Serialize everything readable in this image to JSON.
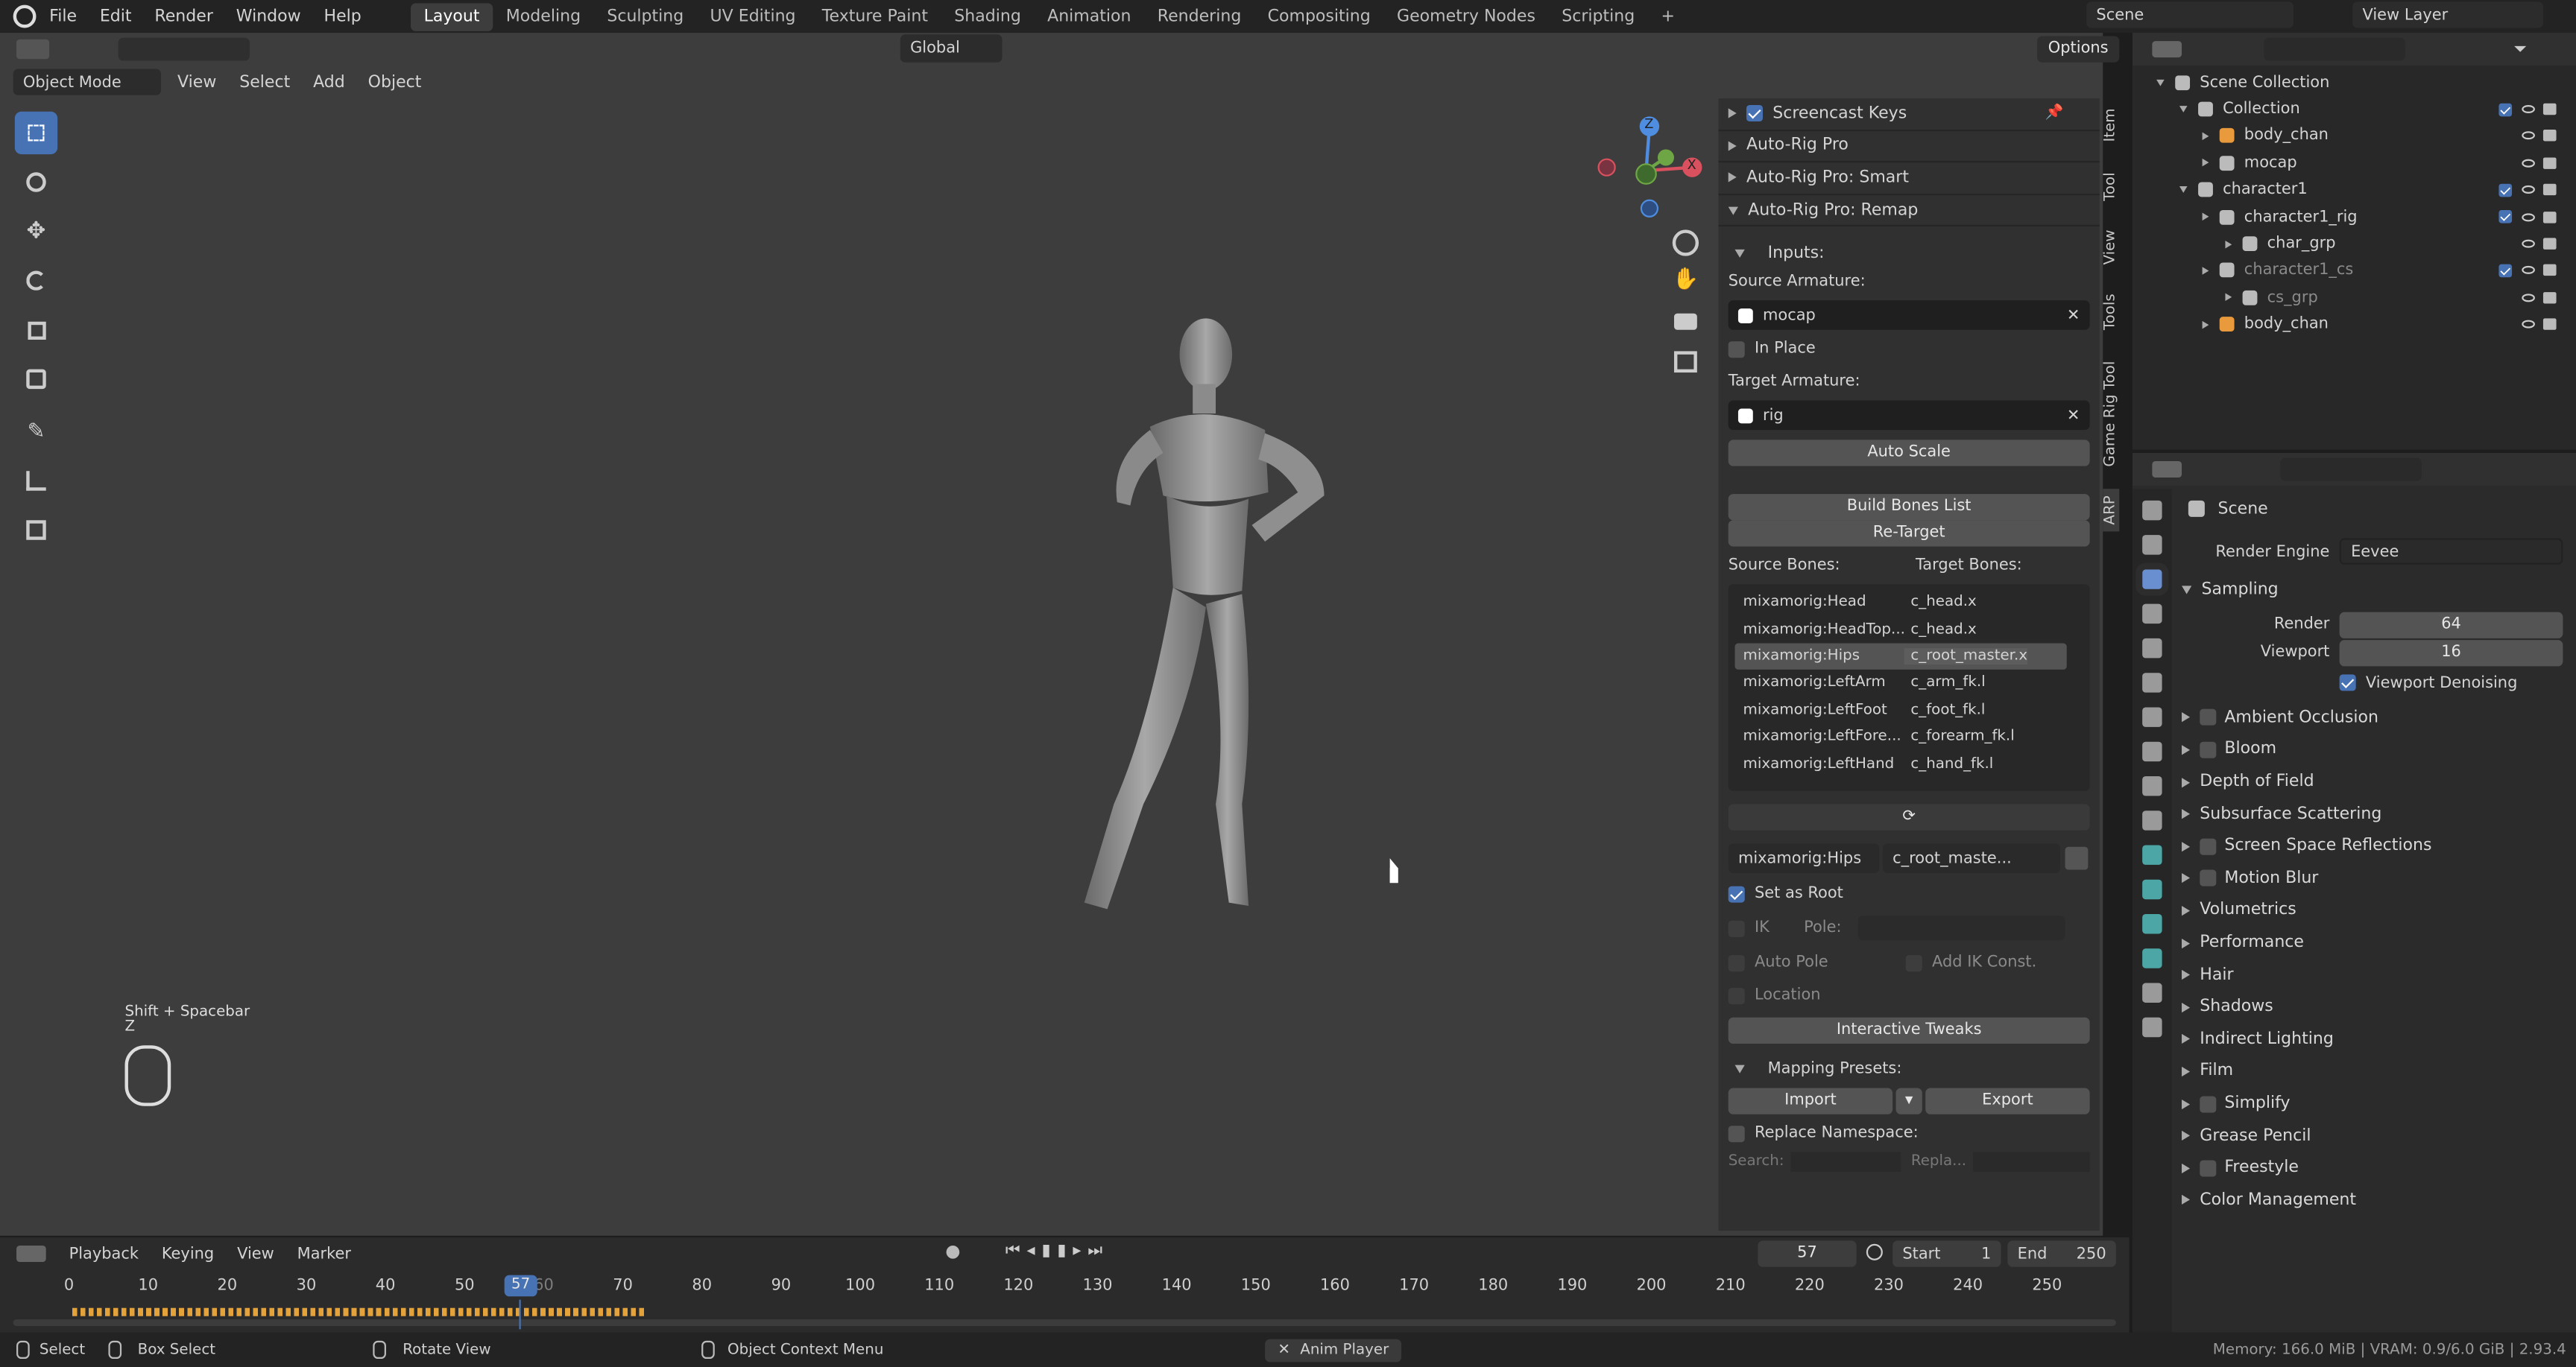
{
  "topbar": {
    "menus": [
      "File",
      "Edit",
      "Render",
      "Window",
      "Help"
    ],
    "workspaces": [
      "Layout",
      "Modeling",
      "Sculpting",
      "UV Editing",
      "Texture Paint",
      "Shading",
      "Animation",
      "Rendering",
      "Compositing",
      "Geometry Nodes",
      "Scripting"
    ],
    "active_workspace": "Layout",
    "add_tab": "+",
    "scene": "Scene",
    "view_layer": "View Layer"
  },
  "viewport_header": {
    "mode": "Object Mode",
    "menus": [
      "View",
      "Select",
      "Add",
      "Object"
    ],
    "orientation": "Global",
    "options": "Options"
  },
  "gizmo": {
    "x": "X",
    "y": "Y",
    "z": "Z"
  },
  "overlay_hint": {
    "keys": "Shift + Spacebar",
    "sub": "Z"
  },
  "npanel": {
    "tabs": [
      "Item",
      "Tool",
      "View",
      "Tools",
      "Game Rig Tool",
      "ARP"
    ],
    "panels": [
      "Screencast Keys",
      "Auto-Rig Pro",
      "Auto-Rig Pro: Smart",
      "Auto-Rig Pro: Remap"
    ],
    "inputs_label": "Inputs:",
    "source_armature_label": "Source Armature:",
    "source_armature": "mocap",
    "in_place": "In Place",
    "target_armature_label": "Target Armature:",
    "target_armature": "rig",
    "auto_scale": "Auto Scale",
    "build_bones": "Build Bones List",
    "retarget": "Re-Target",
    "source_bones_label": "Source Bones:",
    "target_bones_label": "Target Bones:",
    "bones": [
      [
        "mixamorig:Head",
        "c_head.x"
      ],
      [
        "mixamorig:HeadTop...",
        "c_head.x"
      ],
      [
        "mixamorig:Hips",
        "c_root_master.x"
      ],
      [
        "mixamorig:LeftArm",
        "c_arm_fk.l"
      ],
      [
        "mixamorig:LeftFoot",
        "c_foot_fk.l"
      ],
      [
        "mixamorig:LeftFore...",
        "c_forearm_fk.l"
      ],
      [
        "mixamorig:LeftHand",
        "c_hand_fk.l"
      ]
    ],
    "sel_source": "mixamorig:Hips",
    "sel_target": "c_root_maste...",
    "set_as_root": "Set as Root",
    "ik": "IK",
    "pole": "Pole:",
    "auto_pole": "Auto Pole",
    "add_ik": "Add IK Const.",
    "location": "Location",
    "interactive_tweaks": "Interactive Tweaks",
    "mapping_presets": "Mapping Presets:",
    "import": "Import",
    "export": "Export",
    "replace_ns": "Replace Namespace:",
    "search": "Search:",
    "replace": "Repla..."
  },
  "outliner": {
    "rows": [
      {
        "name": "Scene Collection",
        "indent": 0
      },
      {
        "name": "Collection",
        "indent": 1
      },
      {
        "name": "body_chan",
        "indent": 2
      },
      {
        "name": "mocap",
        "indent": 2
      },
      {
        "name": "character1",
        "indent": 1
      },
      {
        "name": "character1_rig",
        "indent": 2
      },
      {
        "name": "char_grp",
        "indent": 3
      },
      {
        "name": "character1_cs",
        "indent": 2
      },
      {
        "name": "cs_grp",
        "indent": 3
      },
      {
        "name": "body_chan",
        "indent": 2
      }
    ]
  },
  "properties": {
    "context": "Scene",
    "render_engine_label": "Render Engine",
    "render_engine": "Eevee",
    "sampling": "Sampling",
    "render_label": "Render",
    "render_val": "64",
    "viewport_label": "Viewport",
    "viewport_val": "16",
    "denoise": "Viewport Denoising",
    "sections": [
      {
        "n": "Ambient Occlusion",
        "c": true
      },
      {
        "n": "Bloom",
        "c": true
      },
      {
        "n": "Depth of Field",
        "c": false
      },
      {
        "n": "Subsurface Scattering",
        "c": false
      },
      {
        "n": "Screen Space Reflections",
        "c": true
      },
      {
        "n": "Motion Blur",
        "c": true
      },
      {
        "n": "Volumetrics",
        "c": false
      },
      {
        "n": "Performance",
        "c": false
      },
      {
        "n": "Hair",
        "c": false
      },
      {
        "n": "Shadows",
        "c": false
      },
      {
        "n": "Indirect Lighting",
        "c": false
      },
      {
        "n": "Film",
        "c": false
      },
      {
        "n": "Simplify",
        "c": true
      },
      {
        "n": "Grease Pencil",
        "c": false
      },
      {
        "n": "Freestyle",
        "c": true
      },
      {
        "n": "Color Management",
        "c": false
      }
    ]
  },
  "timeline": {
    "menus": [
      "Playback",
      "Keying",
      "View",
      "Marker"
    ],
    "current": "57",
    "start_label": "Start",
    "start": "1",
    "end_label": "End",
    "end": "250",
    "ticks": [
      "0",
      "10",
      "20",
      "30",
      "40",
      "50",
      "60",
      "70",
      "80",
      "90",
      "100",
      "110",
      "120",
      "130",
      "140",
      "150",
      "160",
      "170",
      "180",
      "190",
      "200",
      "210",
      "220",
      "230",
      "240",
      "250"
    ]
  },
  "statusbar": {
    "select": "Select",
    "box_select": "Box Select",
    "rotate": "Rotate View",
    "context_menu": "Object Context Menu",
    "anim_player": "Anim Player",
    "memory": "Memory: 166.0 MiB | VRAM: 0.9/6.0 GiB | 2.93.4"
  }
}
